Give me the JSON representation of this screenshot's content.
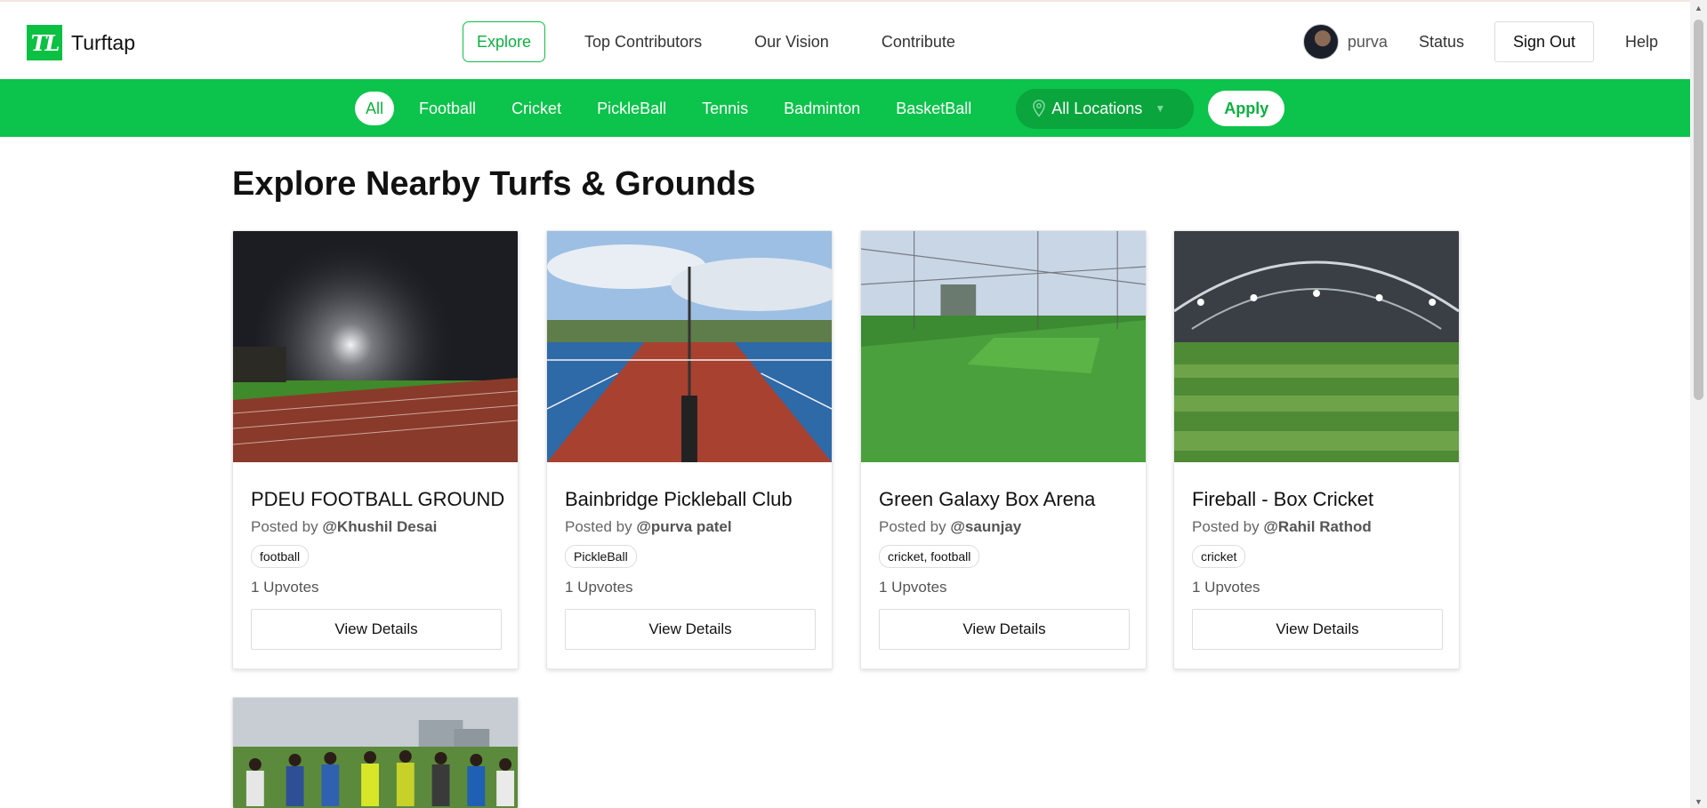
{
  "brand": {
    "logo_text": "TL",
    "name": "Turftap"
  },
  "nav": {
    "links": [
      "Explore",
      "Top Contributors",
      "Our Vision",
      "Contribute"
    ],
    "active": "Explore"
  },
  "user": {
    "name": "purva",
    "status_label": "Status",
    "signout_label": "Sign Out",
    "help_label": "Help"
  },
  "filters": {
    "sports": [
      "All",
      "Football",
      "Cricket",
      "PickleBall",
      "Tennis",
      "Badminton",
      "BasketBall"
    ],
    "active": "All",
    "location": "All Locations",
    "apply_label": "Apply"
  },
  "page_title": "Explore Nearby Turfs & Grounds",
  "cards": [
    {
      "title": "PDEU FOOTBALL GROUND",
      "posted_prefix": "Posted by",
      "author": "@Khushil Desai",
      "tag": "football",
      "upvotes": "1 Upvotes",
      "button": "View Details"
    },
    {
      "title": "Bainbridge Pickleball Club",
      "posted_prefix": "Posted by",
      "author": "@purva patel",
      "tag": "PickleBall",
      "upvotes": "1 Upvotes",
      "button": "View Details"
    },
    {
      "title": "Green Galaxy Box Arena",
      "posted_prefix": "Posted by",
      "author": "@saunjay",
      "tag": "cricket, football",
      "upvotes": "1 Upvotes",
      "button": "View Details"
    },
    {
      "title": "Fireball - Box Cricket",
      "posted_prefix": "Posted by",
      "author": "@Rahil Rathod",
      "tag": "cricket",
      "upvotes": "1 Upvotes",
      "button": "View Details"
    }
  ],
  "colors": {
    "accent": "#0cc34b",
    "accent_dark": "#0aa53d",
    "text": "#111111"
  }
}
